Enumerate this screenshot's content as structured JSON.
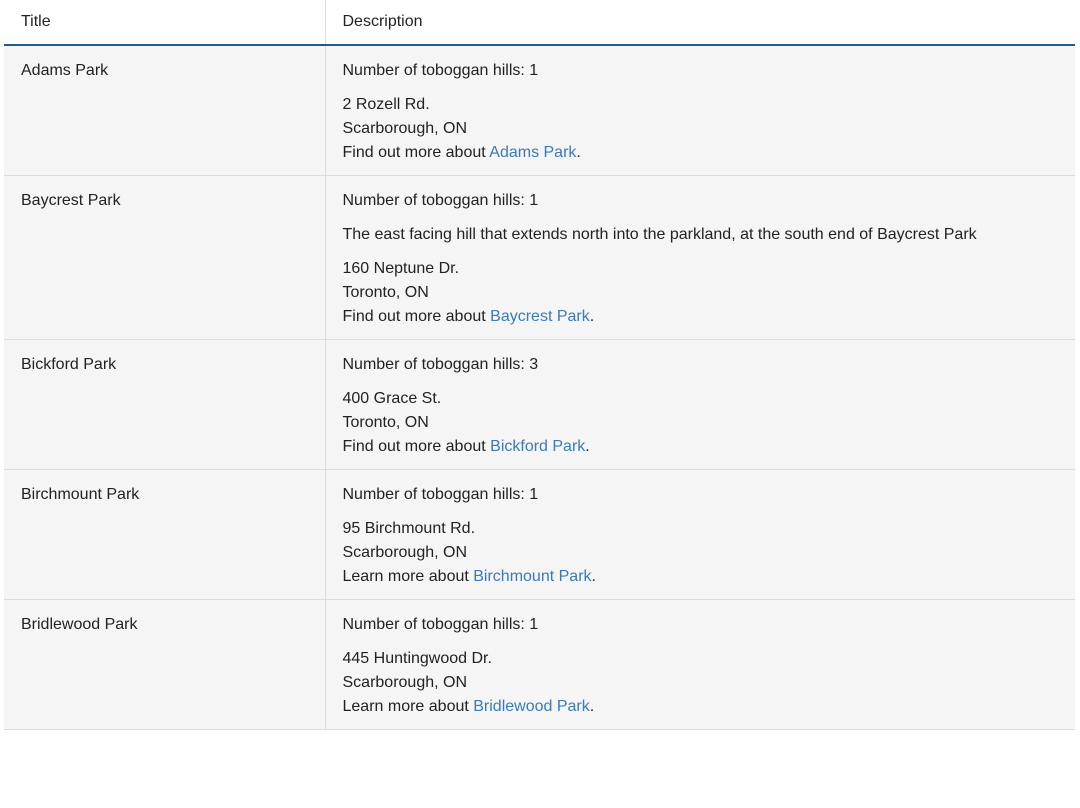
{
  "table": {
    "headers": {
      "title": "Title",
      "description": "Description"
    },
    "rows": [
      {
        "title": "Adams Park",
        "hills": "Number of toboggan hills: 1",
        "note": "",
        "address_line1": "2 Rozell Rd.",
        "address_line2": "Scarborough, ON",
        "more_prefix": "Find out more about ",
        "link_text": "Adams Park",
        "suffix": "."
      },
      {
        "title": "Baycrest Park",
        "hills": "Number of toboggan hills: 1",
        "note": "The east facing hill that extends north into the parkland, at the south end of Baycrest Park",
        "address_line1": "160 Neptune Dr.",
        "address_line2": "Toronto, ON",
        "more_prefix": "Find out more about ",
        "link_text": "Baycrest Park",
        "suffix": "."
      },
      {
        "title": "Bickford Park",
        "hills": "Number of toboggan hills: 3",
        "note": "",
        "address_line1": "400 Grace St.",
        "address_line2": "Toronto, ON",
        "more_prefix": "Find out more about ",
        "link_text": "Bickford Park",
        "suffix": "."
      },
      {
        "title": "Birchmount Park",
        "hills": "Number of toboggan hills: 1",
        "note": "",
        "address_line1": "95 Birchmount Rd.",
        "address_line2": "Scarborough, ON",
        "more_prefix": "Learn more about ",
        "link_text": "Birchmount Park",
        "suffix": "."
      },
      {
        "title": "Bridlewood Park",
        "hills": "Number of toboggan hills: 1",
        "note": "",
        "address_line1": "445 Huntingwood Dr.",
        "address_line2": "Scarborough, ON",
        "more_prefix": "Learn more about ",
        "link_text": "Bridlewood Park",
        "suffix": "."
      }
    ]
  },
  "colors": {
    "link": "#3a7ab8",
    "header_rule": "#215a8f",
    "row_background": "#f5f5f5",
    "border": "#dddddd"
  }
}
